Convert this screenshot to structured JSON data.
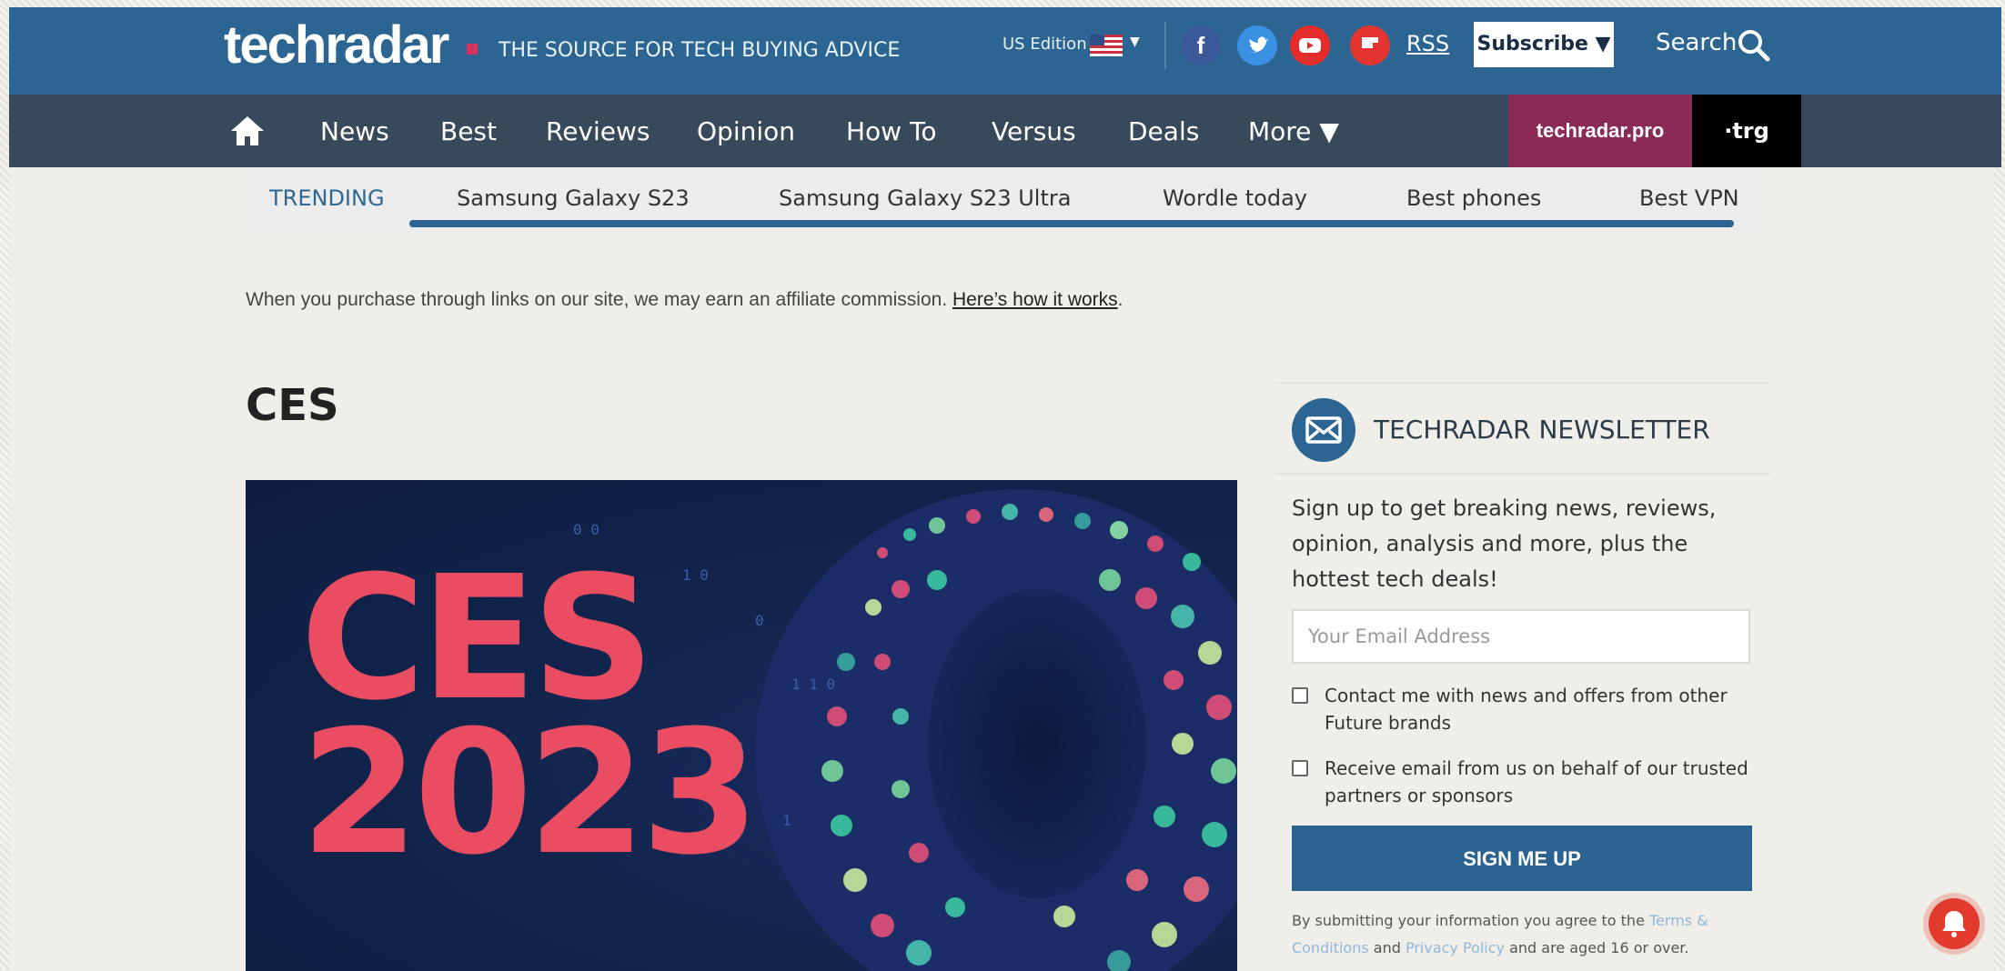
{
  "header": {
    "logo": "techradar",
    "tagline": "THE SOURCE FOR TECH BUYING ADVICE",
    "edition": "US Edition",
    "rss": "RSS",
    "subscribe": "Subscribe ▼",
    "search": "Search"
  },
  "nav": {
    "items": [
      "News",
      "Best",
      "Reviews",
      "Opinion",
      "How To",
      "Versus",
      "Deals",
      "More ▼"
    ],
    "pro_label": "techradar.pro",
    "trg_label": "·trg"
  },
  "trending": {
    "label": "TRENDING",
    "items": [
      "Samsung Galaxy S23",
      "Samsung Galaxy S23 Ultra",
      "Wordle today",
      "Best phones",
      "Best VPN"
    ]
  },
  "disclaimer": {
    "text": "When you purchase through links on our site, we may earn an affiliate commission. ",
    "link": "Here’s how it works",
    "end": "."
  },
  "page": {
    "title": "CES",
    "hero_text_line1": "CES",
    "hero_text_line2": "2023"
  },
  "newsletter": {
    "heading": "TECHRADAR NEWSLETTER",
    "description": "Sign up to get breaking news, reviews, opinion, analysis and more, plus the hottest tech deals!",
    "email_placeholder": "Your Email Address",
    "checkbox1": "Contact me with news and offers from other Future brands",
    "checkbox2": "Receive email from us on behalf of our trusted partners or sponsors",
    "button": "SIGN ME UP",
    "fine_prefix": "By submitting your information you agree to the ",
    "fine_terms": "Terms & Conditions",
    "fine_mid": " and ",
    "fine_privacy": "Privacy Policy",
    "fine_suffix": " and are aged 16 or over."
  },
  "colors": {
    "header_blue": "#2c6591",
    "nav_dark": "#37495b",
    "pro_magenta": "#8a2a57",
    "hero_pink": "#ea4d62"
  }
}
